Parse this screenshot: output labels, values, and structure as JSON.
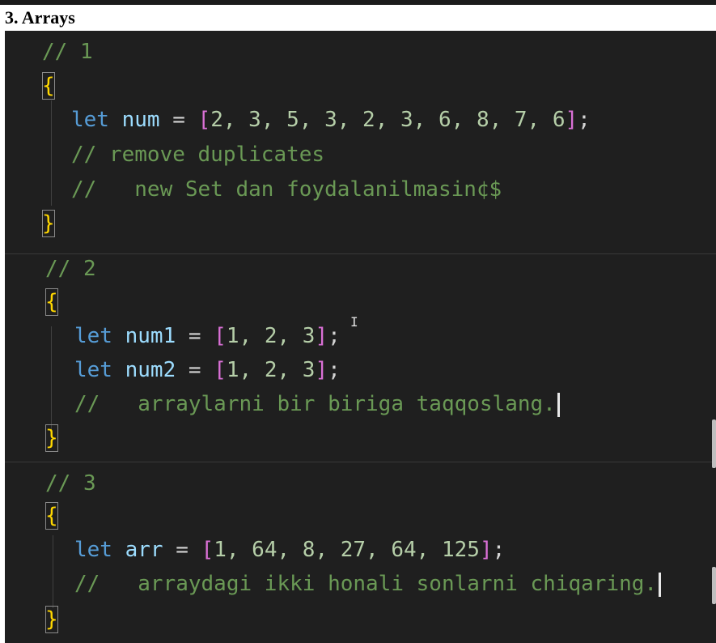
{
  "heading": "3. Arrays",
  "blocks": [
    {
      "label": "// 1",
      "open": "{",
      "close": "}",
      "code": {
        "kw": "let",
        "var": "num",
        "eq": "=",
        "open_sq": "[",
        "values": "2, 3, 5, 3, 2, 3, 6, 8, 7, 6",
        "close_sq": "]",
        "semi": ";"
      },
      "comments": [
        "// remove duplicates",
        "//   new Set dan foydalanilmasin¢$"
      ]
    },
    {
      "label": "// 2",
      "open": "{",
      "close": "}",
      "code_lines": [
        {
          "kw": "let",
          "var": "num1",
          "eq": "=",
          "open_sq": "[",
          "values": "1, 2, 3",
          "close_sq": "]",
          "semi": ";"
        },
        {
          "kw": "let",
          "var": "num2",
          "eq": "=",
          "open_sq": "[",
          "values": "1, 2, 3",
          "close_sq": "]",
          "semi": ";"
        }
      ],
      "comments": [
        "//   arraylarni bir biriga taqqoslang."
      ]
    },
    {
      "label": "// 3",
      "open": "{",
      "close": "}",
      "code": {
        "kw": "let",
        "var": "arr",
        "eq": "=",
        "open_sq": "[",
        "values": "1, 64, 8, 27, 64, 125",
        "close_sq": "]",
        "semi": ";"
      },
      "comments": [
        "//   arraydagi ikki honali sonlarni chiqaring."
      ]
    }
  ],
  "colors": {
    "background": "#1f1f1f",
    "comment": "#6a9955",
    "keyword": "#569cd6",
    "variable": "#9cdcfe",
    "bracket": "#da70d6",
    "brace": "#ffd700"
  },
  "icons": {
    "mouse_cursor": "i-beam-cursor-icon"
  }
}
